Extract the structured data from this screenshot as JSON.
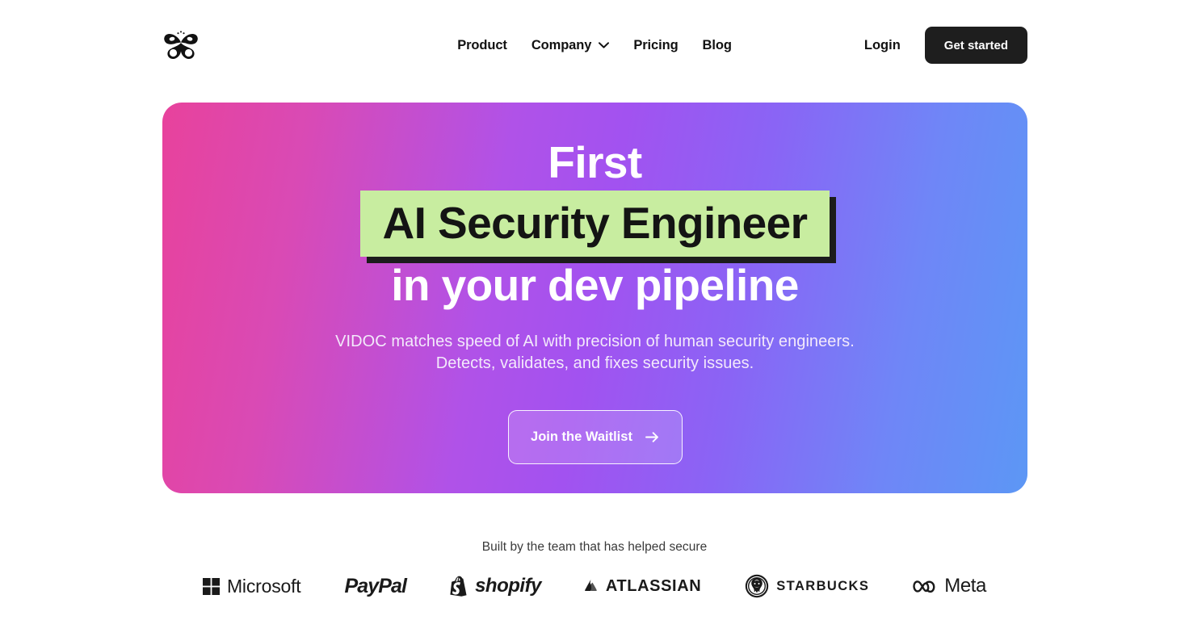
{
  "header": {
    "logo_name": "vidoc-butterfly-logo",
    "nav": [
      {
        "label": "Product",
        "has_dropdown": false
      },
      {
        "label": "Company",
        "has_dropdown": true
      },
      {
        "label": "Pricing",
        "has_dropdown": false
      },
      {
        "label": "Blog",
        "has_dropdown": false
      }
    ],
    "login_label": "Login",
    "get_started_label": "Get started"
  },
  "hero": {
    "headline_line1": "First",
    "headline_highlight": "AI Security Engineer",
    "headline_line3": "in your dev pipeline",
    "subhead_line1": "VIDOC matches speed of AI with precision of human security engineers.",
    "subhead_line2": "Detects, validates, and fixes security issues.",
    "cta_label": "Join the Waitlist",
    "cta_arrow_icon": "arrow-right-icon",
    "gradient_start": "#e8429c",
    "gradient_mid": "#a252f0",
    "gradient_end": "#5c97f5",
    "highlight_bg": "#c8eda0",
    "highlight_shadow": "#1c1c1c",
    "highlight_text_color": "#141414"
  },
  "social_proof": {
    "label": "Built by the team that has helped secure",
    "logos": [
      {
        "name": "Microsoft",
        "icon": "microsoft-squares-icon"
      },
      {
        "name": "PayPal",
        "icon": "paypal-wordmark-icon"
      },
      {
        "name": "shopify",
        "icon": "shopify-bag-icon"
      },
      {
        "name": "ATLASSIAN",
        "icon": "atlassian-mark-icon"
      },
      {
        "name": "STARBUCKS",
        "icon": "starbucks-siren-icon"
      },
      {
        "name": "Meta",
        "icon": "meta-infinity-icon"
      }
    ]
  }
}
